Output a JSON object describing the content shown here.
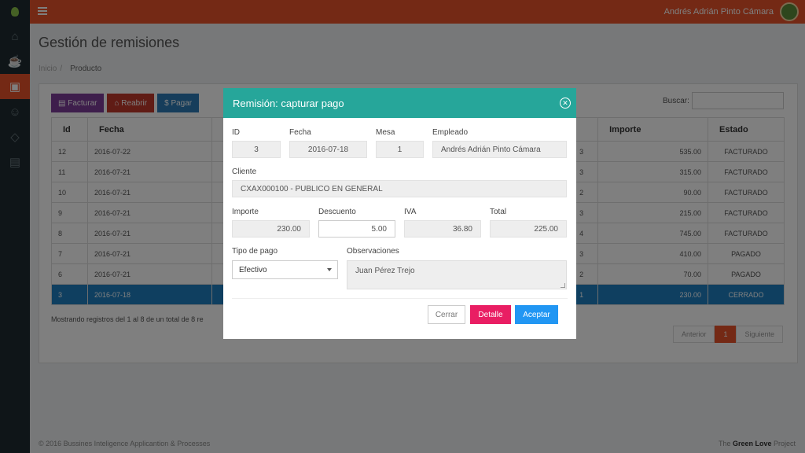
{
  "topbar": {
    "user_name": "Andrés Adrián Pinto Cámara"
  },
  "page": {
    "title": "Gestión de remisiones",
    "breadcrumb_home": "Inicio",
    "breadcrumb_current": "Producto"
  },
  "toolbar": {
    "facturar": "Facturar",
    "reabrir": "Reabrir",
    "pagar": "Pagar",
    "search_label": "Buscar:"
  },
  "table": {
    "headers": {
      "id": "Id",
      "fecha": "Fecha",
      "importe": "Importe",
      "estado": "Estado"
    },
    "rows": [
      {
        "id": "12",
        "fecha": "2016-07-22",
        "mid": "3",
        "importe": "535.00",
        "estado": "FACTURADO"
      },
      {
        "id": "11",
        "fecha": "2016-07-21",
        "mid": "3",
        "importe": "315.00",
        "estado": "FACTURADO"
      },
      {
        "id": "10",
        "fecha": "2016-07-21",
        "mid": "2",
        "importe": "90.00",
        "estado": "FACTURADO"
      },
      {
        "id": "9",
        "fecha": "2016-07-21",
        "mid": "3",
        "importe": "215.00",
        "estado": "FACTURADO"
      },
      {
        "id": "8",
        "fecha": "2016-07-21",
        "mid": "4",
        "importe": "745.00",
        "estado": "FACTURADO"
      },
      {
        "id": "7",
        "fecha": "2016-07-21",
        "mid": "3",
        "importe": "410.00",
        "estado": "PAGADO"
      },
      {
        "id": "6",
        "fecha": "2016-07-21",
        "mid": "2",
        "importe": "70.00",
        "estado": "PAGADO"
      },
      {
        "id": "3",
        "fecha": "2016-07-18",
        "mid": "1",
        "importe": "230.00",
        "estado": "CERRADO"
      }
    ],
    "showing": "Mostrando registros del 1 al 8 de un total de 8 re"
  },
  "pager": {
    "prev": "Anterior",
    "current": "1",
    "next": "Siguiente"
  },
  "footer": {
    "left": "© 2016 Bussines Inteligence Applicantion & Processes",
    "right_prefix": "The ",
    "right_brand": "Green Love",
    "right_suffix": " Project"
  },
  "modal": {
    "title": "Remisión: capturar pago",
    "labels": {
      "id": "ID",
      "fecha": "Fecha",
      "mesa": "Mesa",
      "empleado": "Empleado",
      "cliente": "Cliente",
      "importe": "Importe",
      "descuento": "Descuento",
      "iva": "IVA",
      "total": "Total",
      "tipo_pago": "Tipo de pago",
      "observaciones": "Observaciones"
    },
    "values": {
      "id": "3",
      "fecha": "2016-07-18",
      "mesa": "1",
      "empleado": "Andrés Adrián Pinto Cámara",
      "cliente": "CXAX000100 - PUBLICO EN GENERAL",
      "importe": "230.00",
      "descuento": "5.00",
      "iva": "36.80",
      "total": "225.00",
      "tipo_pago": "Efectivo",
      "observaciones": "Juan Pérez Trejo"
    },
    "buttons": {
      "cerrar": "Cerrar",
      "detalle": "Detalle",
      "aceptar": "Aceptar"
    }
  },
  "colors": {
    "topbar": "#e8532a",
    "modal_header": "#26a69a",
    "detalle": "#e91e63",
    "aceptar": "#2196f3",
    "selected_row": "#1f7fc0"
  }
}
